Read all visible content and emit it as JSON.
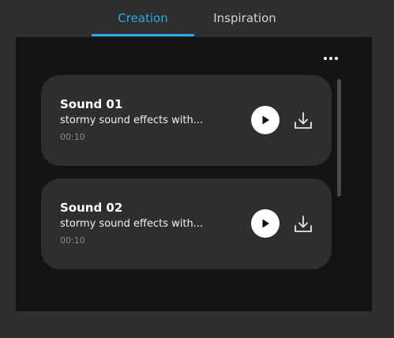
{
  "tabs": {
    "creation": "Creation",
    "inspiration": "Inspiration",
    "active": "Creation"
  },
  "colors": {
    "accent": "#29a9e6",
    "background": "#2e2e2e",
    "panel": "#141414",
    "card": "#2e2e2e"
  },
  "panel": {
    "more_icon": "more-horizontal-icon"
  },
  "sounds": [
    {
      "title": "Sound 01",
      "description": "stormy sound effects with...",
      "duration": "00:10",
      "play_icon": "play-icon",
      "download_icon": "download-icon"
    },
    {
      "title": "Sound 02",
      "description": "stormy sound effects with...",
      "duration": "00:10",
      "play_icon": "play-icon",
      "download_icon": "download-icon"
    }
  ]
}
